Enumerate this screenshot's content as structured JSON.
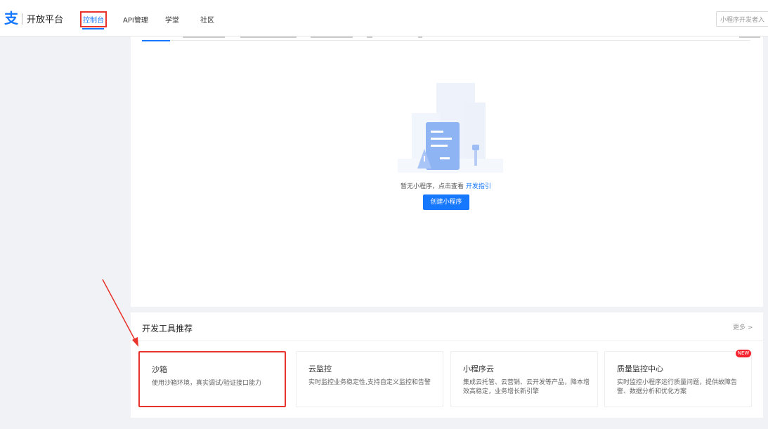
{
  "header": {
    "logo_text": "开放平台",
    "nav": [
      "控制台",
      "API管理",
      "学堂",
      "社区"
    ],
    "search_placeholder": "小程序开发者入"
  },
  "main": {
    "empty_text": "暂无小程序，点击查看",
    "empty_link": "开发指引",
    "create_button": "创建小程序"
  },
  "tools": {
    "title": "开发工具推荐",
    "more": "更多 >",
    "cards": [
      {
        "name": "沙箱",
        "desc": "使用沙箱环境，真实调试/验证接口能力"
      },
      {
        "name": "云监控",
        "desc": "实时监控业务稳定性,支持自定义监控和告警"
      },
      {
        "name": "小程序云",
        "desc": "集成云托管、云营销、云开发等产品，降本增效高稳定，业务增长新引擎"
      },
      {
        "name": "质量监控中心",
        "desc": "实时监控小程序运行质量问题，提供故障告警、数据分析和优化方案",
        "badge": "NEW"
      }
    ]
  },
  "colors": {
    "accent": "#1677ff",
    "highlight": "#e8322b"
  }
}
